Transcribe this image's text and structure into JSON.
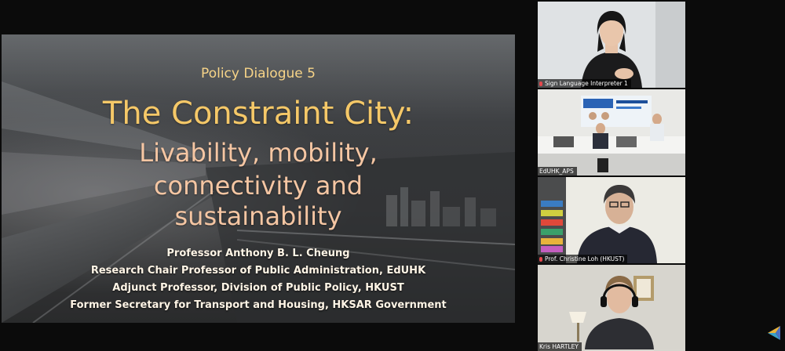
{
  "slide": {
    "series": "Policy Dialogue 5",
    "title": "The Constraint City:",
    "title_lines": [
      "Livability, mobility,",
      "connectivity and",
      "sustainability"
    ],
    "credits": [
      "Professor Anthony B. L. Cheung",
      "Research Chair Professor of Public Administration, EdUHK",
      "Adjunct Professor, Division of Public Policy, HKUST",
      "Former Secretary for Transport and Housing, HKSAR Government"
    ]
  },
  "participants": [
    {
      "name": "Sign Language Interpreter 1"
    },
    {
      "name": "EdUHK_APS"
    },
    {
      "name": "Prof. Christine Loh (HKUST)"
    },
    {
      "name": "Kris HARTLEY"
    }
  ],
  "colors": {
    "title": "#f5c868",
    "subtitle": "#f5c6a3",
    "credit": "#fff5e6",
    "mic_muted": "#e5484d"
  },
  "icons": [
    "mic-muted-icon",
    "app-logo-icon"
  ]
}
